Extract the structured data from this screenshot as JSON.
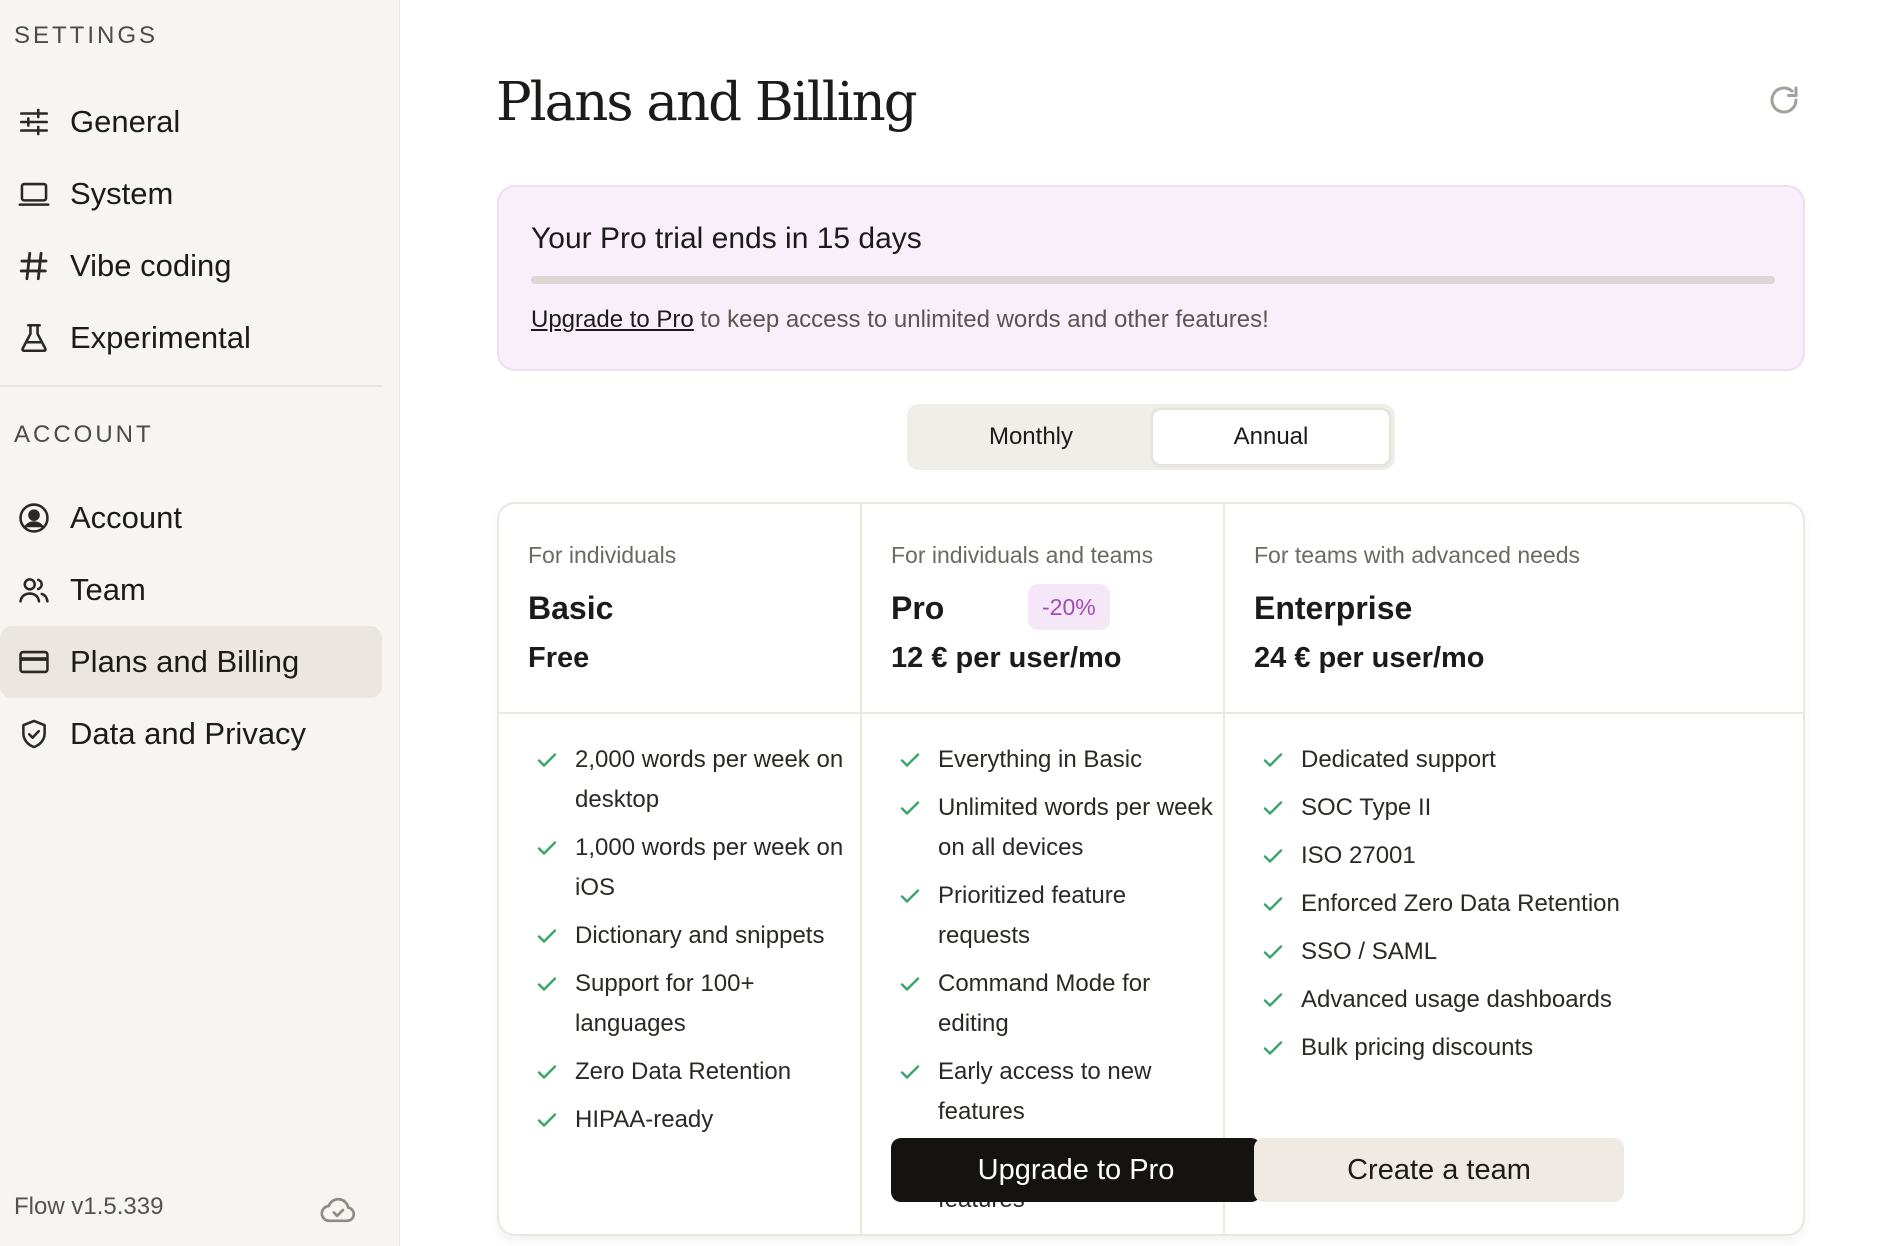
{
  "sidebar": {
    "settings_heading": "SETTINGS",
    "account_heading": "ACCOUNT",
    "settings_items": [
      {
        "label": "General",
        "icon": "sliders-icon"
      },
      {
        "label": "System",
        "icon": "laptop-icon"
      },
      {
        "label": "Vibe coding",
        "icon": "hash-icon"
      },
      {
        "label": "Experimental",
        "icon": "flask-icon"
      }
    ],
    "account_items": [
      {
        "label": "Account",
        "icon": "user-circle-icon"
      },
      {
        "label": "Team",
        "icon": "users-icon"
      },
      {
        "label": "Plans and Billing",
        "icon": "credit-card-icon",
        "active": true
      },
      {
        "label": "Data and Privacy",
        "icon": "shield-check-icon"
      }
    ],
    "version": "Flow v1.5.339"
  },
  "main": {
    "title": "Plans and Billing",
    "trial": {
      "title": "Your Pro trial ends in 15 days",
      "upgrade_link": "Upgrade to Pro",
      "message": " to keep access to unlimited words and other features!"
    },
    "billing_toggle": {
      "monthly": "Monthly",
      "annual": "Annual",
      "selected": "Annual"
    },
    "plans": [
      {
        "audience": "For individuals",
        "name": "Basic",
        "price": "Free",
        "features": [
          "2,000 words per week on desktop",
          "1,000 words per week on iOS",
          "Dictionary and snippets",
          "Support for 100+ languages",
          "Zero Data Retention",
          "HIPAA-ready"
        ]
      },
      {
        "audience": "For individuals and teams",
        "name": "Pro",
        "badge": "-20%",
        "price": "12 € per user/mo",
        "features": [
          "Everything in Basic",
          "Unlimited words per week on all devices",
          "Prioritized feature requests",
          "Command Mode for editing",
          "Early access to new features",
          "Team collaboration features"
        ],
        "cta": "Upgrade to Pro"
      },
      {
        "audience": "For teams with advanced needs",
        "name": "Enterprise",
        "price": "24 € per user/mo",
        "features": [
          "Dedicated support",
          "SOC Type II",
          "ISO 27001",
          "Enforced Zero Data Retention",
          "SSO / SAML",
          "Advanced usage dashboards",
          "Bulk pricing discounts"
        ],
        "cta": "Create a team"
      }
    ]
  },
  "colors": {
    "accent_purple": "#a34cb8",
    "check_green": "#3aa56b",
    "sidebar_bg": "#f6f5f2",
    "banner_bg": "#f8effb"
  }
}
